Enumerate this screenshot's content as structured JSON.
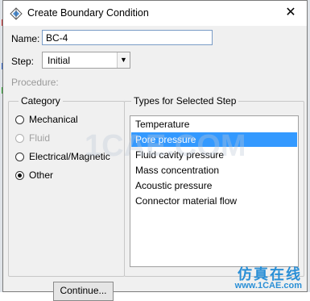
{
  "dialog": {
    "title": "Create Boundary Condition",
    "name_label": "Name:",
    "name_value": "BC-4",
    "step_label": "Step:",
    "step_value": "Initial",
    "procedure_label": "Procedure:",
    "continue_label": "Continue..."
  },
  "category": {
    "title": "Category",
    "options": [
      {
        "label": "Mechanical",
        "selected": false,
        "enabled": true
      },
      {
        "label": "Fluid",
        "selected": false,
        "enabled": false
      },
      {
        "label": "Electrical/Magnetic",
        "selected": false,
        "enabled": true
      },
      {
        "label": "Other",
        "selected": true,
        "enabled": true
      }
    ]
  },
  "types": {
    "title": "Types for Selected Step",
    "items": [
      "Temperature",
      "Pore pressure",
      "Fluid cavity pressure",
      "Mass concentration",
      "Acoustic pressure",
      "Connector material flow"
    ],
    "selected": "Pore pressure"
  },
  "watermark": {
    "center": "1CAE.COM",
    "brand": "仿真在线",
    "url": "www.1CAE.com"
  },
  "colors": {
    "selection": "#3399ff",
    "watermark": "#2a8fd6"
  }
}
